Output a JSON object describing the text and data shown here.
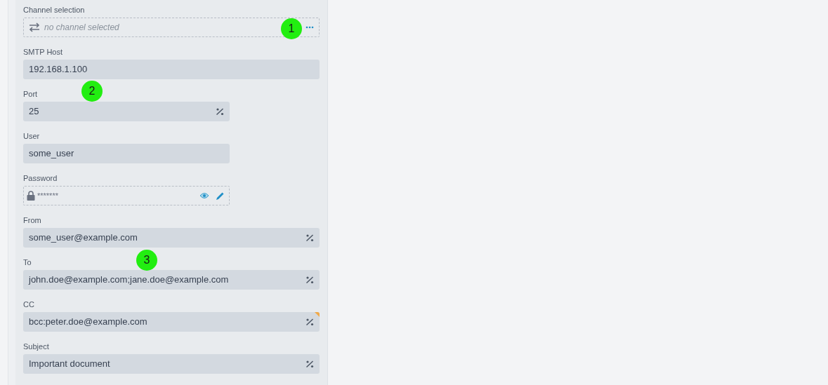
{
  "fields": [
    {
      "kind": "channel",
      "label": "Channel selection",
      "placeholder": "no channel selected",
      "half_width": false,
      "variable": false,
      "flagged": false
    },
    {
      "kind": "text",
      "label": "SMTP Host",
      "value": "192.168.1.100",
      "half_width": false,
      "variable": false,
      "flagged": false
    },
    {
      "kind": "text",
      "label": "Port",
      "value": "25",
      "half_width": true,
      "variable": true,
      "flagged": false
    },
    {
      "kind": "text",
      "label": "User",
      "value": "some_user",
      "half_width": true,
      "variable": false,
      "flagged": false
    },
    {
      "kind": "password",
      "label": "Password",
      "value": "*******",
      "half_width": true,
      "variable": false,
      "flagged": false
    },
    {
      "kind": "text",
      "label": "From",
      "value": "some_user@example.com",
      "half_width": false,
      "variable": true,
      "flagged": false
    },
    {
      "kind": "text",
      "label": "To",
      "value": "john.doe@example.com;jane.doe@example.com",
      "half_width": false,
      "variable": true,
      "flagged": false
    },
    {
      "kind": "text",
      "label": "CC",
      "value": "bcc:peter.doe@example.com",
      "half_width": false,
      "variable": true,
      "flagged": true
    },
    {
      "kind": "text",
      "label": "Subject",
      "value": "Important document",
      "half_width": false,
      "variable": true,
      "flagged": false
    }
  ],
  "markers": [
    {
      "label": "1"
    },
    {
      "label": "2"
    },
    {
      "label": "3"
    }
  ]
}
